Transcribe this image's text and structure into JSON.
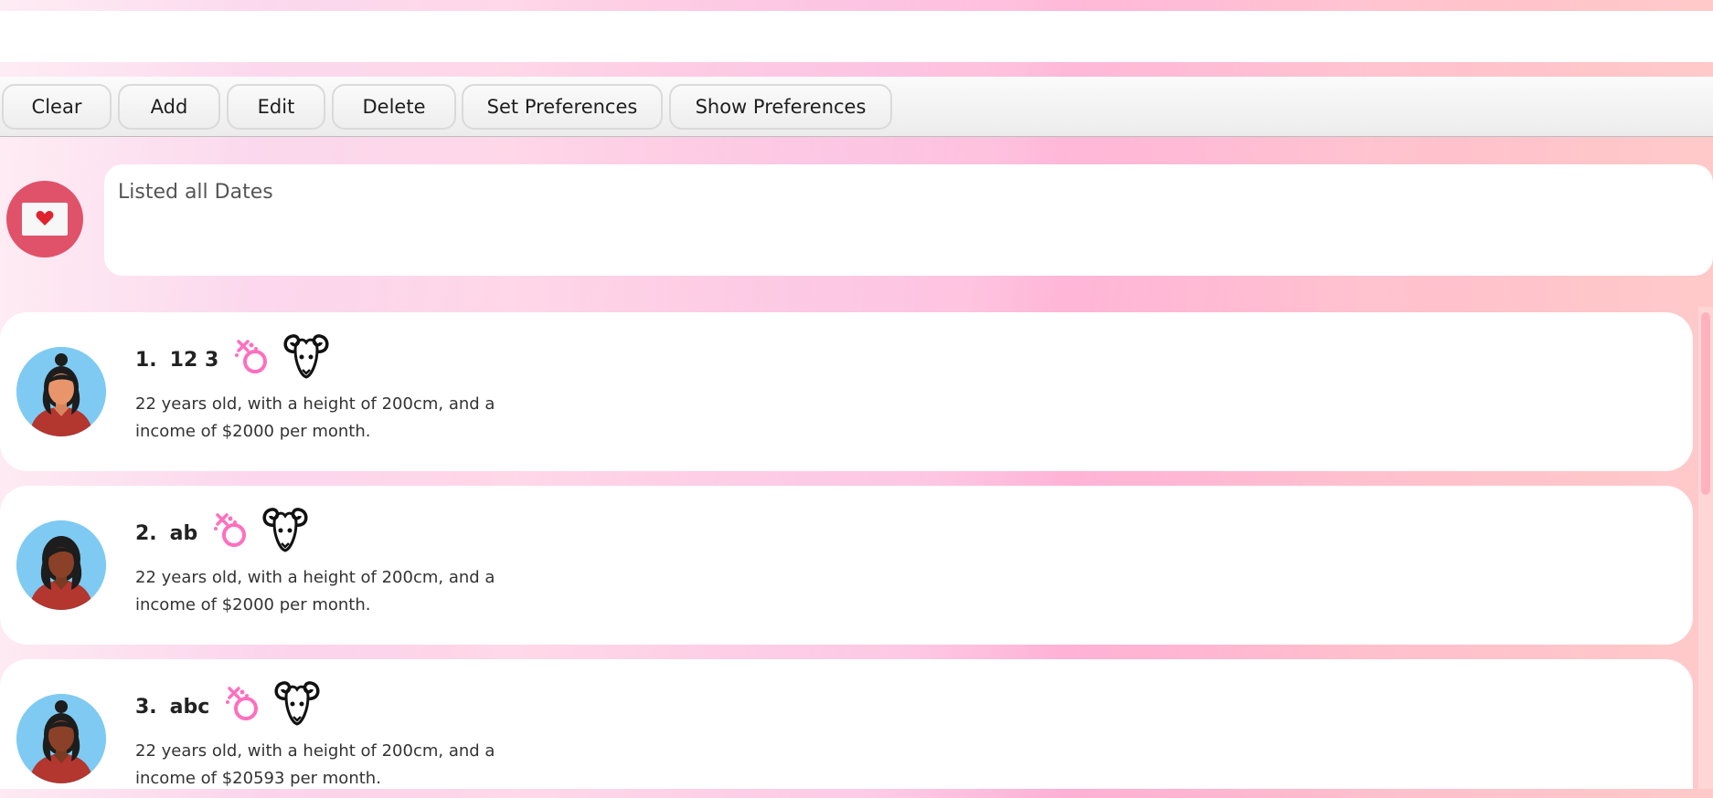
{
  "command_box": {
    "value": ""
  },
  "toolbar": {
    "buttons": [
      {
        "label": "Clear"
      },
      {
        "label": "Add"
      },
      {
        "label": "Edit"
      },
      {
        "label": "Delete"
      },
      {
        "label": "Set Preferences"
      },
      {
        "label": "Show Preferences"
      }
    ]
  },
  "result": {
    "icon": "envelope-heart-icon",
    "text": "Listed all Dates"
  },
  "dates": [
    {
      "index": "1.",
      "name": "12 3",
      "gender_icon": "female-gender-icon",
      "zodiac_icon": "aries-ram-icon",
      "avatar": "woman-avatar-light",
      "description": "22 years old, with a height of 200cm, and a income of $2000 per month."
    },
    {
      "index": "2.",
      "name": "ab",
      "gender_icon": "female-gender-icon",
      "zodiac_icon": "aries-ram-icon",
      "avatar": "woman-avatar-dark",
      "description": "22 years old, with a height of 200cm, and a income of $2000 per month."
    },
    {
      "index": "3.",
      "name": "abc",
      "gender_icon": "female-gender-icon",
      "zodiac_icon": "aries-ram-icon",
      "avatar": "woman-avatar-dark-bun",
      "description": "22 years old, with a height of 200cm, and a income of $20593 per month."
    }
  ],
  "colors": {
    "accent_pink": "#ff6fbf",
    "result_avatar": "#e0526a",
    "avatar_bg": "#7fcaf2",
    "shirt": "#b3362f"
  }
}
